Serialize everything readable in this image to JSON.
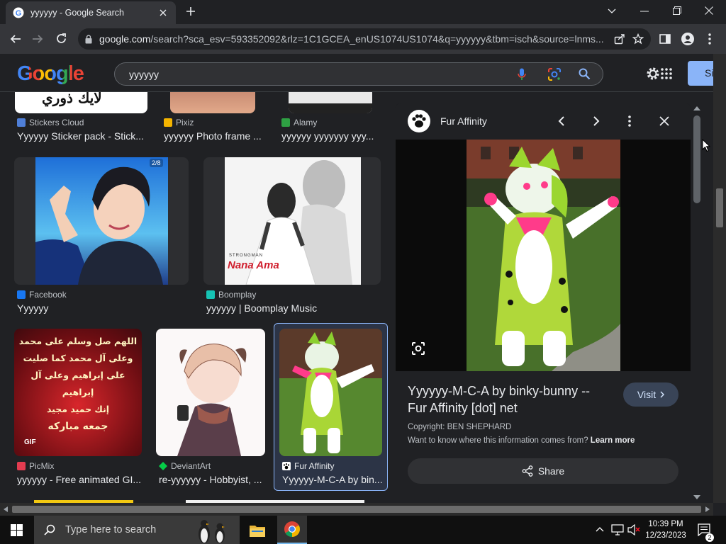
{
  "tab": {
    "title": "yyyyyy - Google Search"
  },
  "omnibox": {
    "host": "google.com",
    "path": "/search?sca_esv=593352092&rlz=1C1GCEA_enUS1074US1074&q=yyyyyy&tbm=isch&source=lnms..."
  },
  "header": {
    "logo": "Google",
    "query": "yyyyyy",
    "signin_label": "Si"
  },
  "results": [
    {
      "source": "Stickers Cloud",
      "title": "Yyyyyy Sticker pack - Stick...",
      "favicon_color": "#4f7fd8"
    },
    {
      "source": "Pixiz",
      "title": "yyyyyy Photo frame ...",
      "favicon_color": "#f4b400"
    },
    {
      "source": "Alamy",
      "title": "yyyyyy yyyyyyy yyy...",
      "favicon_color": "#2ea043"
    },
    {
      "source": "Facebook",
      "title": "Yyyyyy",
      "favicon_color": "#1877f2",
      "badge": "2/8"
    },
    {
      "source": "Boomplay",
      "title": "yyyyyy | Boomplay Music",
      "favicon_color": "#16c2b3"
    },
    {
      "source": "PicMix",
      "title": "yyyyyy - Free animated GI...",
      "favicon_color": "#e33c50"
    },
    {
      "source": "DeviantArt",
      "title": "re-yyyyyy - Hobbyist, ...",
      "favicon_color": "#05cc47"
    },
    {
      "source": "Fur Affinity",
      "title": "Yyyyyy-M-C-A by bin...",
      "favicon_color": "#ffffff"
    }
  ],
  "image_texts": {
    "stronger": "STRONGMAN",
    "nana": "Nana Ama",
    "arabic_lines": [
      "اللهم صل وسلم على محمد",
      "وعلى آل محمد كما صليت",
      "على إبراهيم وعلى آل إبراهيم",
      "إنك حميد مجيد",
      "جمعه مباركه"
    ],
    "gif": "GIF",
    "sticker_text": "لايك ذوري"
  },
  "panel": {
    "source": "Fur Affinity",
    "title": "Yyyyyy-M-C-A by binky-bunny -- Fur Affinity [dot] net",
    "visit_label": "Visit",
    "copyright": "Copyright: BEN SHEPHARD",
    "want_know": "Want to know where this information comes from?",
    "learn_more": "Learn more",
    "share_label": "Share"
  },
  "taskbar": {
    "search_placeholder": "Type here to search",
    "time": "10:39 PM",
    "date": "12/23/2023",
    "notification_count": "2"
  }
}
